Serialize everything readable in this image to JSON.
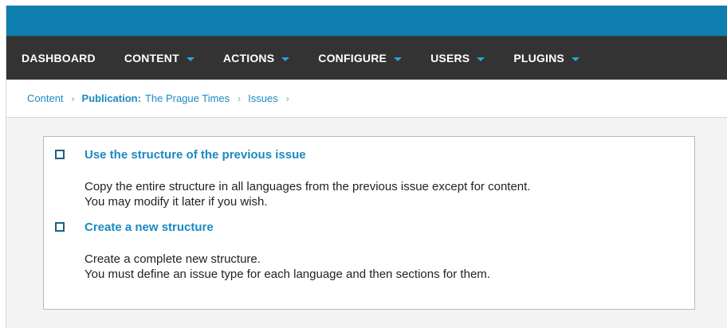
{
  "nav": {
    "items": [
      {
        "label": "DASHBOARD"
      },
      {
        "label": "CONTENT"
      },
      {
        "label": "ACTIONS"
      },
      {
        "label": "CONFIGURE"
      },
      {
        "label": "USERS"
      },
      {
        "label": "PLUGINS"
      }
    ]
  },
  "breadcrumb": {
    "content": "Content",
    "publication_label": "Publication:",
    "publication_name": "The Prague Times",
    "issues": "Issues",
    "separator": "›"
  },
  "options": [
    {
      "title": "Use the structure of the previous issue",
      "lines": [
        "Copy the entire structure in all languages from the previous issue except for content.",
        "You may modify it later if you wish."
      ]
    },
    {
      "title": "Create a new structure",
      "lines": [
        "Create a complete new structure.",
        "You must define an issue type for each language and then sections for them."
      ]
    }
  ],
  "colors": {
    "topbar": "#0e7fae",
    "navbar": "#333333",
    "accent": "#1a8ac2"
  }
}
